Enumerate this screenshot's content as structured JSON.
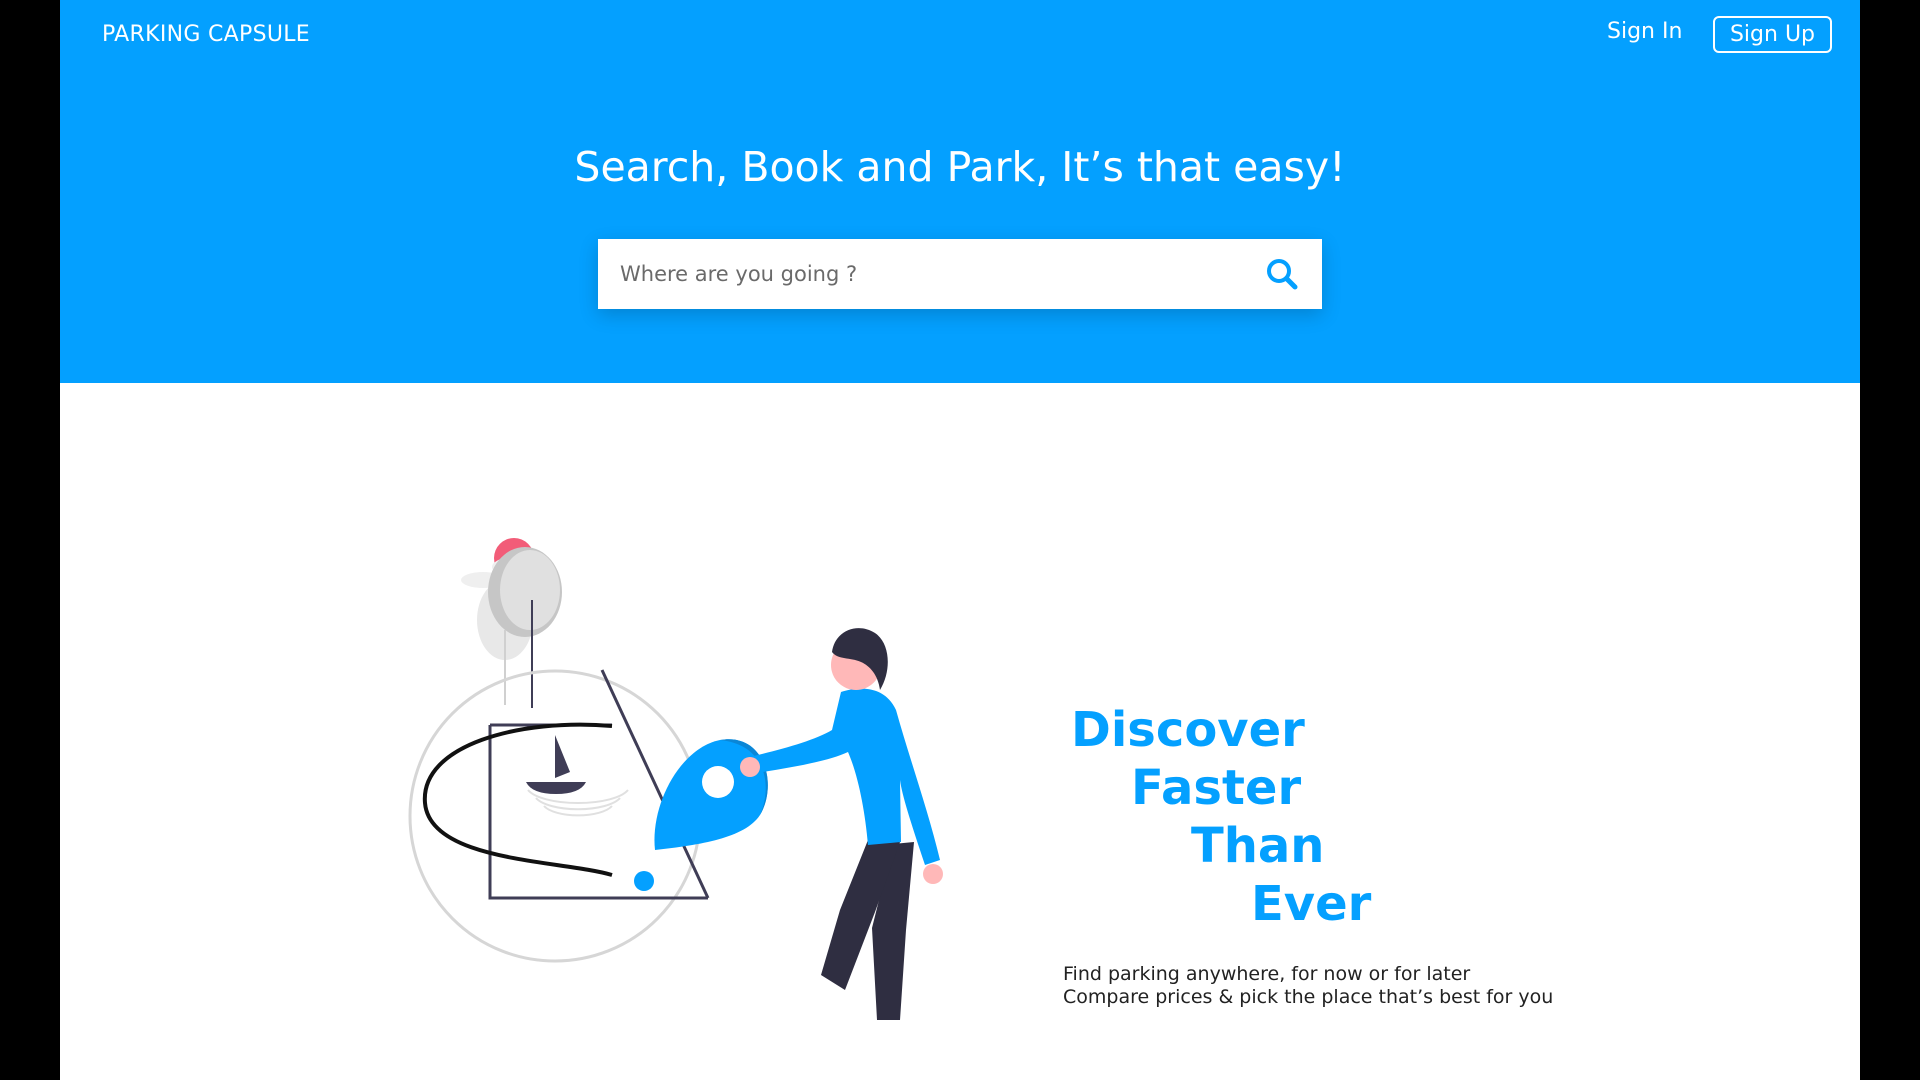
{
  "brand": "PARKING CAPSULE",
  "nav": {
    "sign_in": "Sign In",
    "sign_up": "Sign Up"
  },
  "hero": {
    "headline": "Search, Book and Park, It’s that easy!",
    "search_placeholder": "Where are you going ?"
  },
  "tagline": [
    "Discover",
    "Faster",
    "Than",
    "Ever"
  ],
  "description": [
    "Find parking anywhere, for now or for later",
    "Compare prices & pick the place that’s best for you"
  ],
  "colors": {
    "primary": "#04a0ff",
    "accent_sun": "#f25c78",
    "pants": "#2f2e41"
  },
  "icons": {
    "search": "search-icon"
  }
}
